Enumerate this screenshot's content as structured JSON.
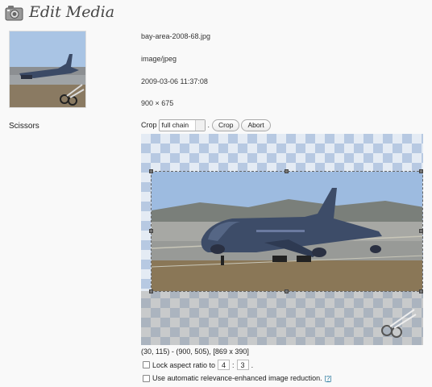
{
  "header": {
    "title": "Edit Media",
    "icon": "media-camera-icon"
  },
  "sidebar": {
    "filter_name": "Scissors"
  },
  "file_info": {
    "filename": "bay-area-2008-68.jpg",
    "mime_type": "image/jpeg",
    "date": "2009-03-06 11:37:08",
    "dimensions": "900 × 675"
  },
  "crop_toolbar": {
    "label": "Crop",
    "select_value": "full chain",
    "separator": ".",
    "crop_button": "Crop",
    "abort_button": "Abort"
  },
  "selection": {
    "coords_text": "(30, 115) - (900, 505), [869 x 390]"
  },
  "options": {
    "lock_aspect_label": "Lock aspect ratio to",
    "ratio_w": "4",
    "ratio_sep": ":",
    "ratio_h": "3",
    "ratio_end": ".",
    "auto_reduction_label": "Use automatic relevance-enhanced image reduction.",
    "help_link": "[?]"
  }
}
